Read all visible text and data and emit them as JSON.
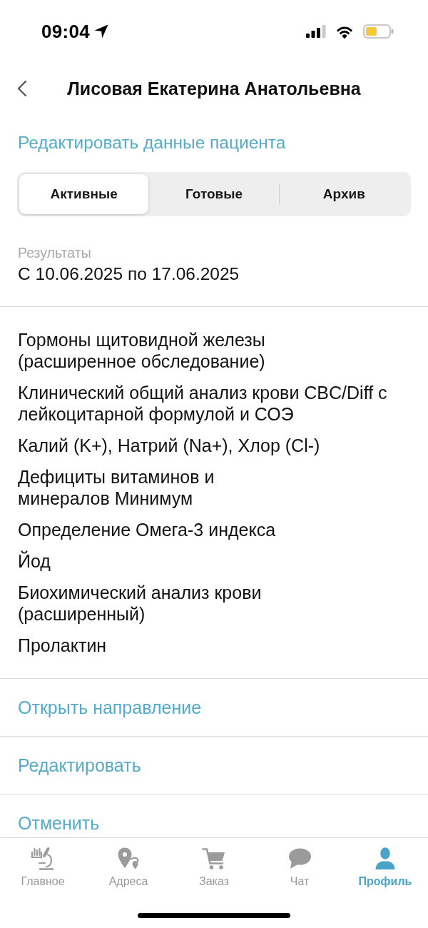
{
  "status_bar": {
    "time": "09:04"
  },
  "header": {
    "title": "Лисовая Екатерина Анатольевна"
  },
  "edit_patient_link": "Редактировать данные пациента",
  "segments": [
    {
      "label": "Активные",
      "selected": true
    },
    {
      "label": "Готовые",
      "selected": false
    },
    {
      "label": "Архив",
      "selected": false
    }
  ],
  "results": {
    "label": "Результаты",
    "period": "С 10.06.2025 по 17.06.2025"
  },
  "tests": [
    "Гормоны щитовидной железы\n(расширенное обследование)",
    "Клинический общий анализ крови CBC/Diff с\nлейкоцитарной формулой и СОЭ",
    "Калий (K+), Натрий (Na+), Хлор (Cl-)",
    "Дефициты витаминов и\nминералов Минимум",
    "Определение Омега-3 индекса",
    "Йод",
    "Биохимический анализ крови\n(расширенный)",
    "Пролактин"
  ],
  "actions": [
    "Открыть направление",
    "Редактировать",
    "Отменить"
  ],
  "tab_bar": [
    {
      "label": "Главное",
      "kind": "lab",
      "selected": false
    },
    {
      "label": "Адреса",
      "kind": "addresses",
      "selected": false
    },
    {
      "label": "Заказ",
      "kind": "cart",
      "selected": false
    },
    {
      "label": "Чат",
      "kind": "chat",
      "selected": false
    },
    {
      "label": "Профиль",
      "kind": "profile",
      "selected": true
    }
  ]
}
